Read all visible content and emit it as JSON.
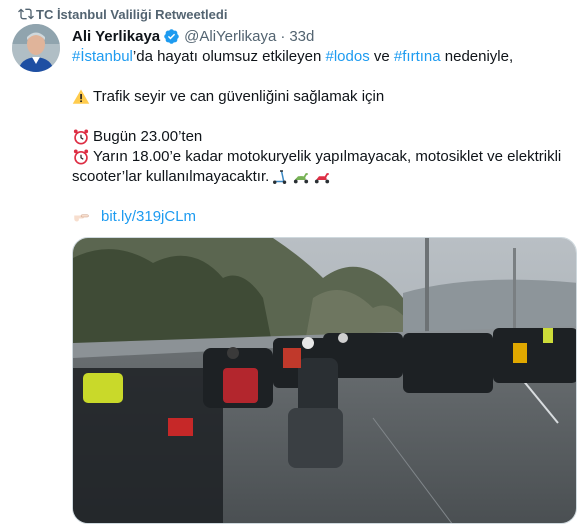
{
  "retweet": {
    "text": "TC İstanbul Valiliği Retweetledi"
  },
  "author": {
    "name": "Ali Yerlikaya",
    "handle": "@AliYerlikaya",
    "time": "33d",
    "separator": "·"
  },
  "tweet": {
    "line1": {
      "tag1": "#İstanbul",
      "t1": "’da hayatı olumsuz etkileyen ",
      "tag2": "#lodos",
      "t2": " ve ",
      "tag3": "#fırtına",
      "t3": " nedeniyle,"
    },
    "line2": "Trafik seyir ve can güvenliğini sağlamak için",
    "line3": "Bugün 23.00’ten",
    "line4": "Yarın 18.00’e kadar motokuryelik yapılmayacak, motosiklet ve elektrikli",
    "line5": "scooter’lar kullanılmayacaktır.",
    "link": "bit.ly/319jCLm"
  },
  "icons": {
    "retweet": "retweet-icon",
    "verified": "verified-badge-icon",
    "warning": "warning-icon",
    "alarm": "alarm-clock-icon",
    "scooter": "kick-scooter-icon",
    "moped": "motor-scooter-icon",
    "pointer": "backhand-index-pointing-right-icon"
  },
  "colors": {
    "accent": "#1d9bf0",
    "secondary": "#536471",
    "text": "#0f1419"
  }
}
